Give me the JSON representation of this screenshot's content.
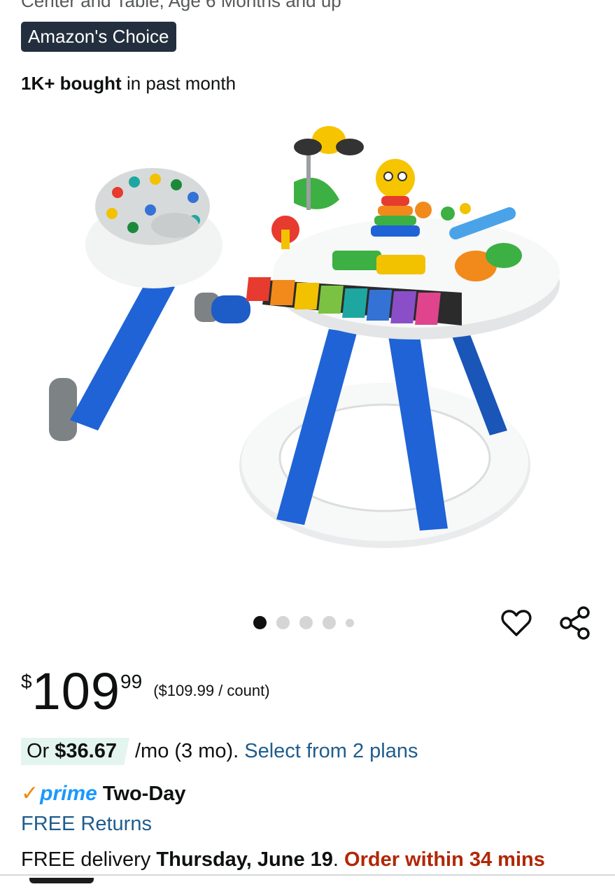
{
  "product": {
    "title_cut": "Center and Table, Age 6 Months and up",
    "badge": "Amazon's Choice",
    "bought_strong": "1K+ bought",
    "bought_rest": " in past month"
  },
  "gallery": {
    "image_count": 5,
    "active_index": 0
  },
  "price": {
    "symbol": "$",
    "whole": "109",
    "fraction": "99",
    "per_unit": "($109.99 / count)"
  },
  "installment": {
    "lead": "Or ",
    "amount": "$36.67",
    "term": "/mo (3 mo).",
    "link": "Select from 2 plans"
  },
  "shipping": {
    "prime_check": "✓",
    "prime_label": "prime",
    "speed": "Two-Day",
    "returns": "FREE Returns",
    "delivery_prefix": "FREE delivery ",
    "delivery_date": "Thursday, June 19",
    "delivery_sep": ". ",
    "order_within": "Order within 34 mins"
  },
  "icons": {
    "wishlist": "heart-icon",
    "share": "share-icon"
  },
  "colors": {
    "badge_bg": "#232f3e",
    "link": "#1f5d8e",
    "prime_blue": "#1a98ff",
    "prime_check": "#f08804",
    "urgent": "#b12704",
    "installment_bg": "#e3f5ee"
  }
}
